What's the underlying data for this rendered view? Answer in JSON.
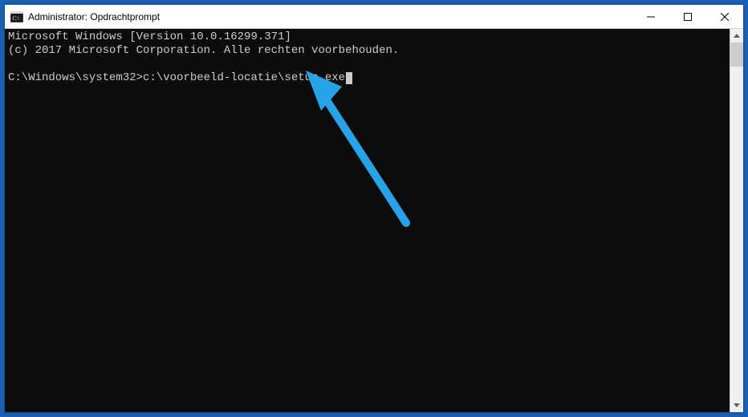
{
  "window": {
    "title": "Administrator: Opdrachtprompt"
  },
  "terminal": {
    "line1": "Microsoft Windows [Version 10.0.16299.371]",
    "line2": "(c) 2017 Microsoft Corporation. Alle rechten voorbehouden.",
    "blank": "",
    "prompt": "C:\\Windows\\system32>",
    "command": "c:\\voorbeeld-locatie\\setup.exe"
  }
}
